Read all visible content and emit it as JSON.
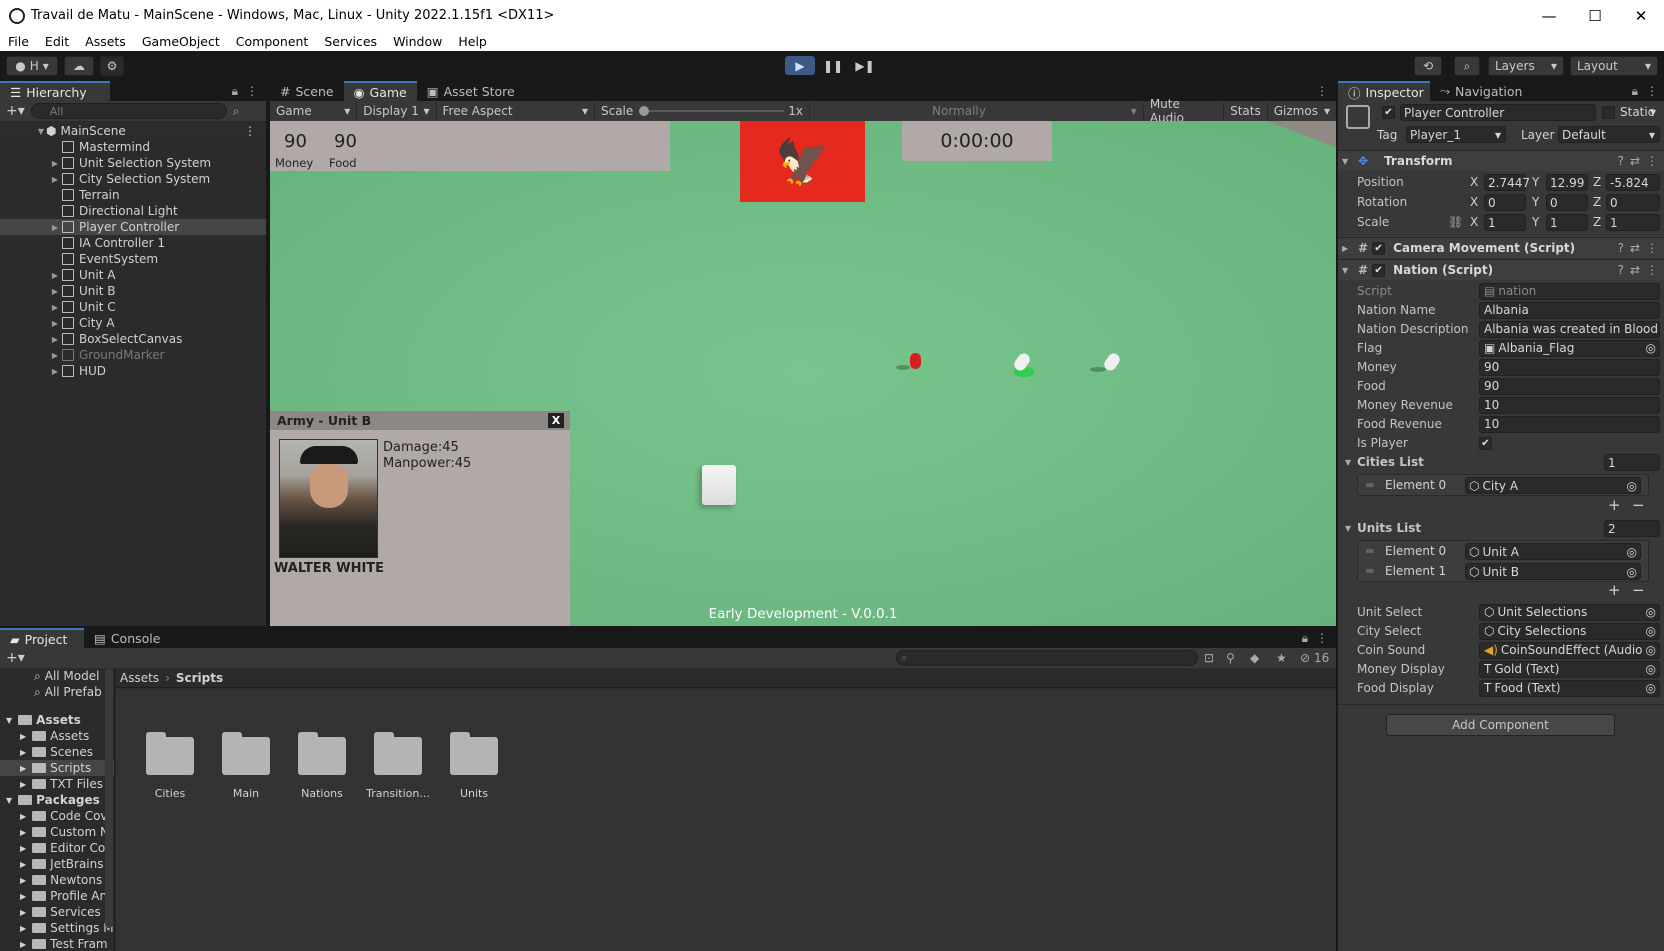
{
  "window": {
    "title": "Travail de Matu - MainScene - Windows, Mac, Linux - Unity 2022.1.15f1 <DX11>",
    "minimize": "—",
    "maximize": "☐",
    "close": "✕"
  },
  "menu": [
    "File",
    "Edit",
    "Assets",
    "GameObject",
    "Component",
    "Services",
    "Window",
    "Help"
  ],
  "toolbar": {
    "account": "H",
    "layers": "Layers",
    "layout": "Layout",
    "play": "▶",
    "pause": "❚❚",
    "step": "▶❚"
  },
  "hierarchy": {
    "tab": "Hierarchy",
    "search_placeholder": "All",
    "scene": "MainScene",
    "items": [
      "Mastermind",
      "Unit Selection System",
      "City Selection System",
      "Terrain",
      "Directional Light",
      "Player Controller",
      "IA Controller 1",
      "EventSystem",
      "Unit A",
      "Unit B",
      "Unit C",
      "City A",
      "BoxSelectCanvas",
      "GroundMarker",
      "HUD"
    ]
  },
  "game_tabs": {
    "scene": "Scene",
    "game": "Game",
    "asset_store": "Asset Store"
  },
  "game_toolbar": {
    "mode": "Game",
    "display": "Display 1",
    "aspect": "Free Aspect",
    "scale_label": "Scale",
    "scale_value": "1x",
    "vsync": "Normally",
    "mute": "Mute Audio",
    "stats": "Stats",
    "gizmos": "Gizmos"
  },
  "game": {
    "money_value": "90",
    "money_label": "Money",
    "food_value": "90",
    "food_label": "Food",
    "timer": "0:00:00",
    "flag_glyph": "🦅",
    "army_title": "Army - Unit B",
    "army_close": "X",
    "damage": "Damage:45",
    "manpower": "Manpower:45",
    "portrait_name": "WALTER WHITE",
    "footer": "Early Development - V.0.0.1"
  },
  "inspector": {
    "tabs": {
      "inspector": "Inspector",
      "navigation": "Navigation"
    },
    "object_name": "Player Controller",
    "static_label": "Static",
    "tag_label": "Tag",
    "tag_value": "Player_1",
    "layer_label": "Layer",
    "layer_value": "Default",
    "transform": {
      "title": "Transform",
      "position_label": "Position",
      "pos": [
        "2.7447",
        "12.99",
        "-5.824"
      ],
      "rotation_label": "Rotation",
      "rot": [
        "0",
        "0",
        "0"
      ],
      "scale_label": "Scale",
      "scale": [
        "1",
        "1",
        "1"
      ],
      "axes": [
        "X",
        "Y",
        "Z"
      ]
    },
    "camera_movement": "Camera Movement (Script)",
    "nation": {
      "title": "Nation (Script)",
      "fields": [
        {
          "label": "Script",
          "value": "nation"
        },
        {
          "label": "Nation Name",
          "value": "Albania"
        },
        {
          "label": "Nation Description",
          "value": "Albania was created in Blood"
        },
        {
          "label": "Flag",
          "value": "Albania_Flag"
        },
        {
          "label": "Money",
          "value": "90"
        },
        {
          "label": "Food",
          "value": "90"
        },
        {
          "label": "Money Revenue",
          "value": "10"
        },
        {
          "label": "Food Revenue",
          "value": "10"
        },
        {
          "label": "Is Player",
          "value": "✔"
        }
      ],
      "cities_label": "Cities List",
      "cities_count": "1",
      "cities": [
        {
          "label": "Element 0",
          "value": "City A"
        }
      ],
      "units_label": "Units List",
      "units_count": "2",
      "units": [
        {
          "label": "Element 0",
          "value": "Unit A"
        },
        {
          "label": "Element 1",
          "value": "Unit B"
        }
      ],
      "refs": [
        {
          "label": "Unit Select",
          "value": "Unit Selections"
        },
        {
          "label": "City Select",
          "value": "City Selections"
        },
        {
          "label": "Coin Sound",
          "value": "CoinSoundEffect (Audio S"
        },
        {
          "label": "Money Display",
          "value": "Gold (Text)"
        },
        {
          "label": "Food Display",
          "value": "Food (Text)"
        }
      ]
    },
    "add_component": "Add Component"
  },
  "project": {
    "tabs": {
      "project": "Project",
      "console": "Console"
    },
    "count": "16",
    "breadcrumb": [
      "Assets",
      "Scripts"
    ],
    "tree": [
      {
        "label": "All Model",
        "indent": 2,
        "kind": "search"
      },
      {
        "label": "All Prefab",
        "indent": 2,
        "kind": "search"
      },
      {
        "label": "Assets",
        "indent": 0,
        "kind": "root"
      },
      {
        "label": "Assets",
        "indent": 1,
        "kind": "folder"
      },
      {
        "label": "Scenes",
        "indent": 1,
        "kind": "folder"
      },
      {
        "label": "Scripts",
        "indent": 1,
        "kind": "folder"
      },
      {
        "label": "TXT Files",
        "indent": 1,
        "kind": "folder"
      },
      {
        "label": "Packages",
        "indent": 0,
        "kind": "root"
      },
      {
        "label": "Code Cov",
        "indent": 1,
        "kind": "folder"
      },
      {
        "label": "Custom N",
        "indent": 1,
        "kind": "folder"
      },
      {
        "label": "Editor Co",
        "indent": 1,
        "kind": "folder"
      },
      {
        "label": "JetBrains",
        "indent": 1,
        "kind": "folder"
      },
      {
        "label": "Newtons",
        "indent": 1,
        "kind": "folder"
      },
      {
        "label": "Profile An",
        "indent": 1,
        "kind": "folder"
      },
      {
        "label": "Services",
        "indent": 1,
        "kind": "folder"
      },
      {
        "label": "Settings M",
        "indent": 1,
        "kind": "folder"
      },
      {
        "label": "Test Fram",
        "indent": 1,
        "kind": "folder"
      }
    ],
    "folders": [
      "Cities",
      "Main",
      "Nations",
      "Transition...",
      "Units"
    ]
  }
}
